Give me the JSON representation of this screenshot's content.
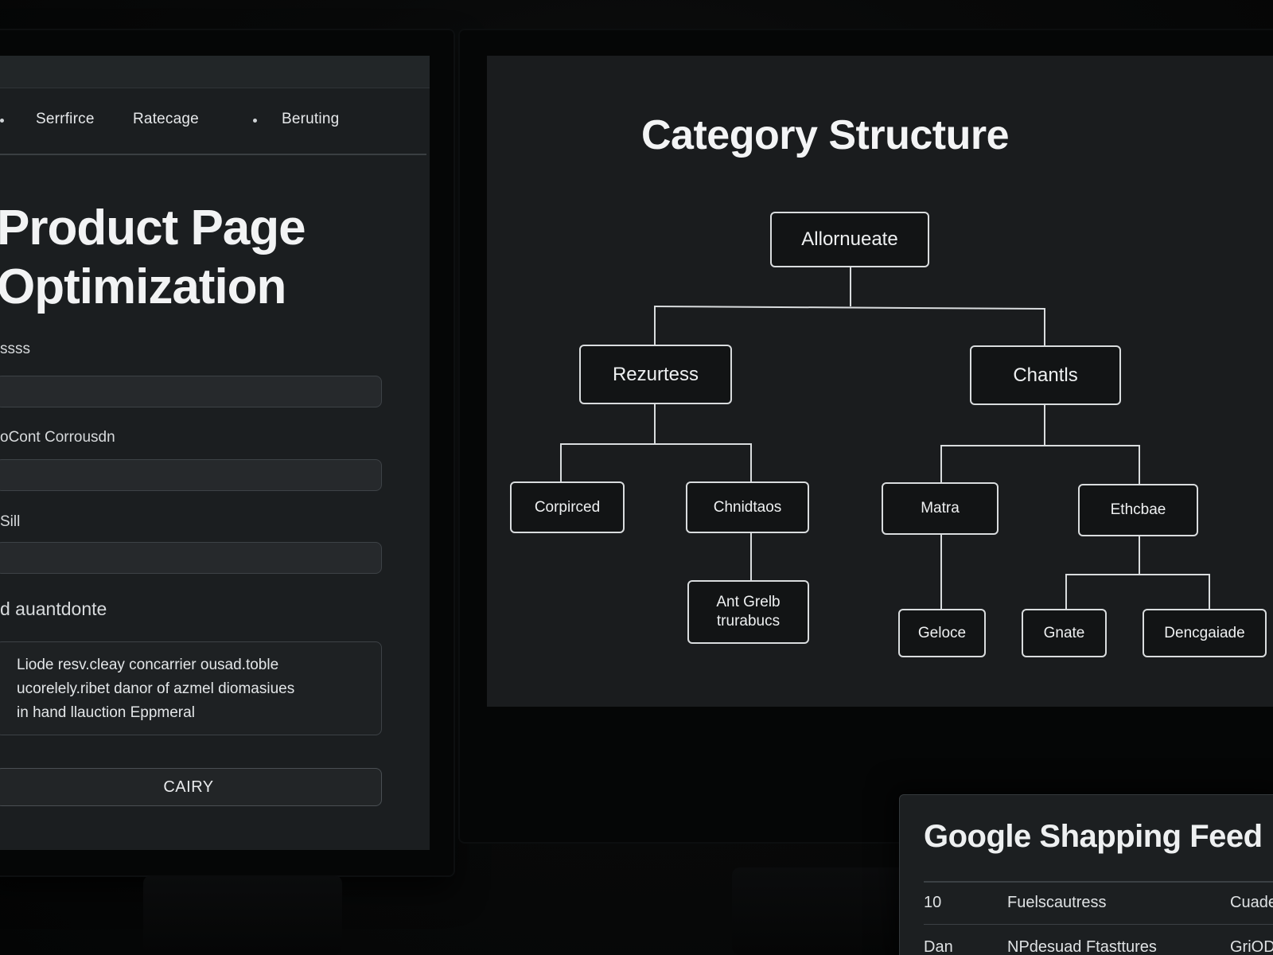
{
  "left_screen": {
    "nav": {
      "items": [
        "Serrfirce",
        "Ratecage",
        "Beruting"
      ]
    },
    "title_line1": "Product Page",
    "title_line2": "Optimization",
    "fields": [
      {
        "label": "ssss"
      },
      {
        "label": "oCont Corrousdn"
      },
      {
        "label": "Sill"
      }
    ],
    "description": {
      "label": "d auantdonte",
      "lines": [
        "Liode resv.cleay concarrier ousad.toble",
        "ucorelely.ribet danor of azmel diomasiues",
        "in hand llauction Eppmeral"
      ]
    },
    "submit_label": "CAIRY"
  },
  "category_structure": {
    "title": "Category Structure",
    "root": "Allornueate",
    "level1": [
      "Rezurtess",
      "Chantls"
    ],
    "level2": [
      "Corpirced",
      "Chnidtaos",
      "Matra",
      "Ethcbae"
    ],
    "level3": [
      {
        "parent": "Chnidtaos",
        "line1": "Ant Grelb",
        "line2": "trurabucs"
      },
      {
        "parent": "Matra",
        "label": "Geloce"
      },
      {
        "parent": "Ethcbae",
        "label": "Gnate"
      },
      {
        "parent": "Ethcbae",
        "label": "Dencgaiade"
      }
    ]
  },
  "shopping_feed": {
    "title": "Google Shapping Feed",
    "rows": [
      [
        "10",
        "Fuelscautress",
        "Cuade"
      ],
      [
        "Dan",
        "NPdesuad Ftasttures",
        "GriOD"
      ]
    ]
  }
}
